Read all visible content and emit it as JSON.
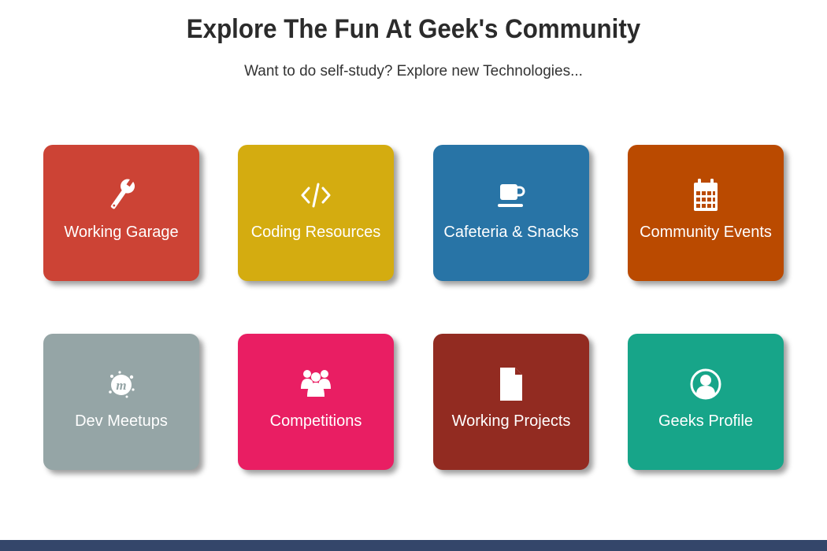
{
  "header": {
    "title": "Explore The Fun At Geek's Community",
    "subtitle": "Want to do self-study? Explore new Technologies..."
  },
  "cards": [
    {
      "label": "Working Garage",
      "icon": "wrench-icon",
      "color": "#cc4335"
    },
    {
      "label": "Coding Resources",
      "icon": "code-icon",
      "color": "#d4ac10"
    },
    {
      "label": "Cafeteria & Snacks",
      "icon": "coffee-cup-icon",
      "color": "#2874a6"
    },
    {
      "label": "Community Events",
      "icon": "calendar-icon",
      "color": "#ba4a00"
    },
    {
      "label": "Dev Meetups",
      "icon": "meetup-icon",
      "color": "#95a5a6"
    },
    {
      "label": "Competitions",
      "icon": "users-group-icon",
      "color": "#e91e63"
    },
    {
      "label": "Working Projects",
      "icon": "file-icon",
      "color": "#922b21"
    },
    {
      "label": "Geeks Profile",
      "icon": "user-circle-icon",
      "color": "#17a589"
    }
  ],
  "footer": {
    "color": "#34466a"
  }
}
